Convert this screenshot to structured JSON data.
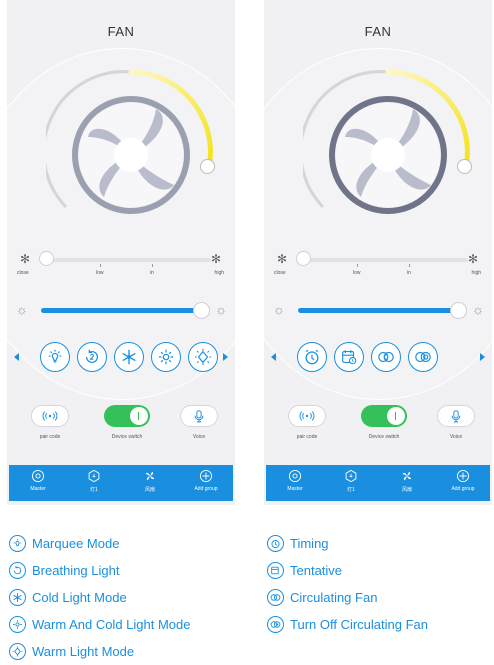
{
  "colors": {
    "accent": "#1a8fe0",
    "switch_on": "#35c15a",
    "dial_arc": "#f2e31c"
  },
  "screens": [
    {
      "title": "FAN",
      "speed": {
        "close_label": "close",
        "high_label": "high",
        "ticks": [
          "low",
          "in"
        ]
      },
      "brightness_level": 1.0,
      "mode_icons": [
        "marquee-mode-icon",
        "breathing-light-icon",
        "cold-light-mode-icon",
        "warm-and-cold-light-mode-icon",
        "warm-light-mode-icon"
      ],
      "controls": {
        "pair": "pair code",
        "switch": "Device switch",
        "voice": "Voice"
      },
      "tabs": [
        "Master",
        "灯1",
        "风扇",
        "Add group"
      ]
    },
    {
      "title": "FAN",
      "speed": {
        "close_label": "close",
        "high_label": "high",
        "ticks": [
          "low",
          "in"
        ]
      },
      "brightness_level": 1.0,
      "mode_icons": [
        "timing-icon",
        "tentative-icon",
        "circulating-fan-icon",
        "turn-off-circulating-fan-icon"
      ],
      "controls": {
        "pair": "pair code",
        "switch": "Device switch",
        "voice": "Voice"
      },
      "tabs": [
        "Master",
        "灯1",
        "风扇",
        "Add group"
      ]
    }
  ],
  "legend_left": [
    "Marquee Mode",
    "Breathing Light",
    "Cold Light Mode",
    "Warm And Cold Light Mode",
    "Warm Light Mode"
  ],
  "legend_right": [
    "Timing",
    "Tentative",
    "Circulating  Fan",
    "Turn Off Circulating  Fan"
  ]
}
